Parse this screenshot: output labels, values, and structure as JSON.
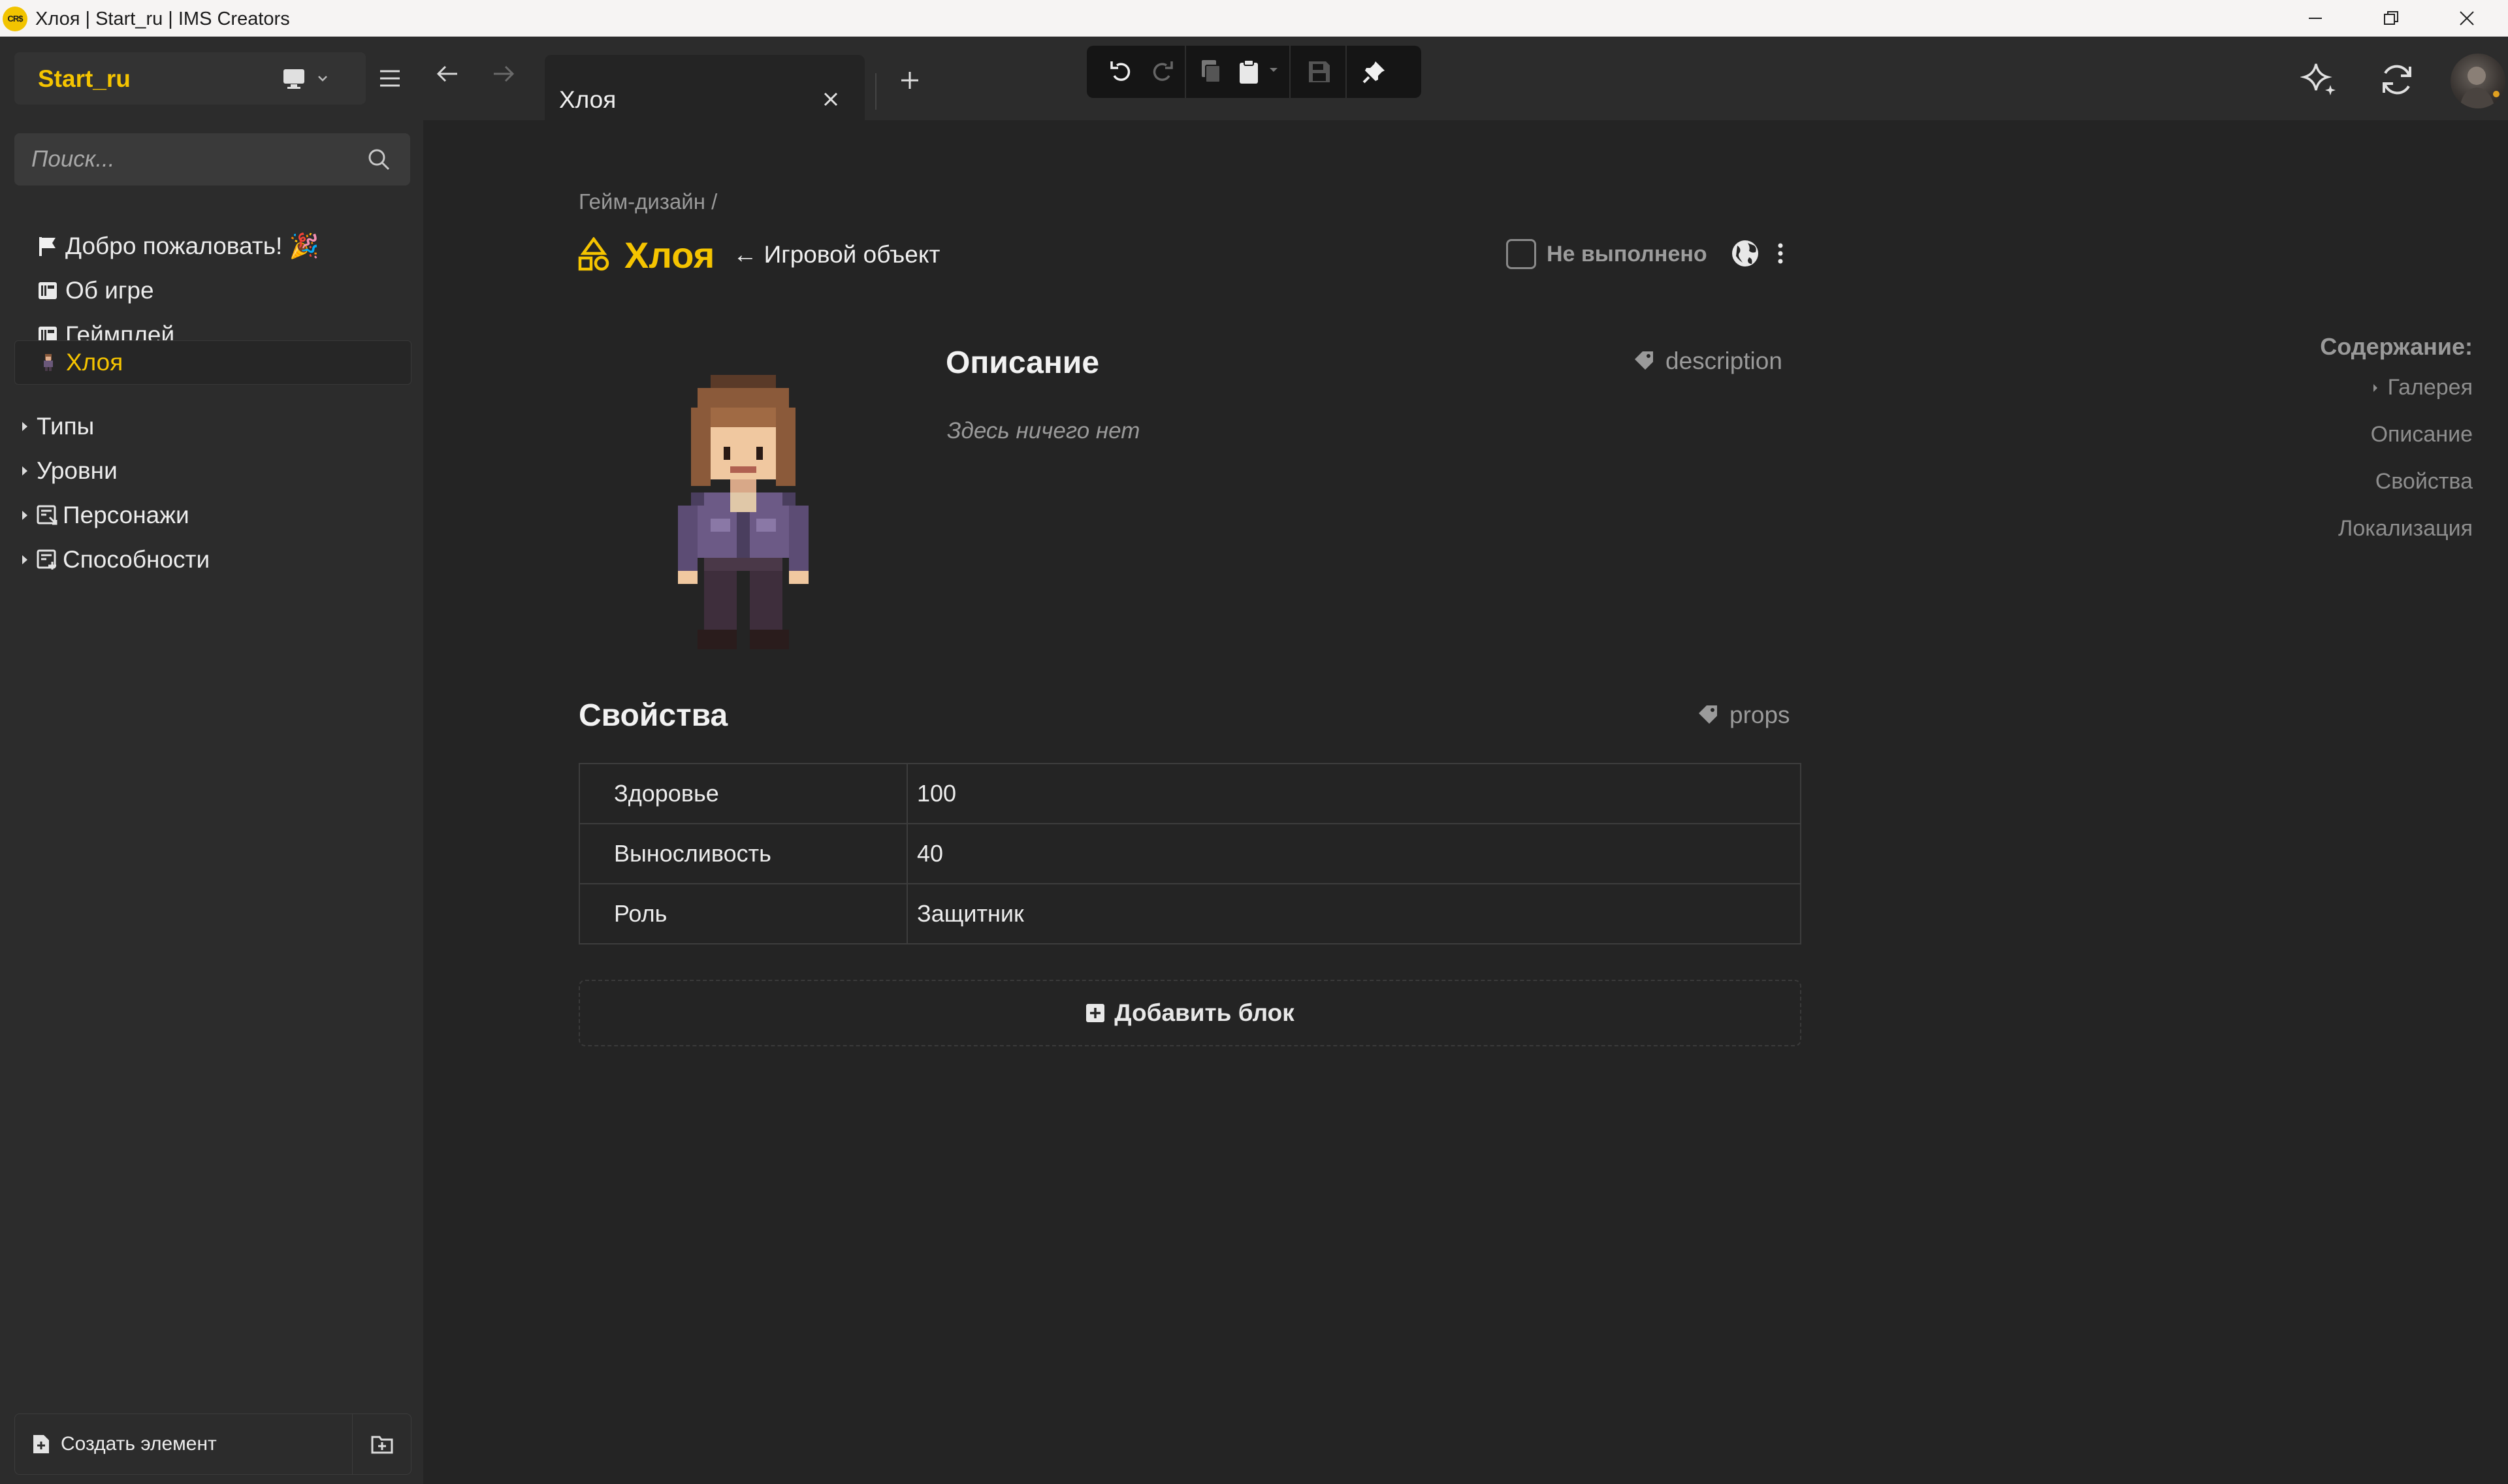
{
  "window": {
    "logo_text": "CR$",
    "title": "Хлоя | Start_ru | IMS Creators"
  },
  "sidebar": {
    "workspace": "Start_ru",
    "search_placeholder": "Поиск...",
    "items": [
      {
        "label": "Добро пожаловать! 🎉",
        "icon": "flag-icon"
      },
      {
        "label": "Об игре",
        "icon": "doc-card-icon"
      },
      {
        "label": "Геймплей",
        "icon": "doc-card-icon"
      },
      {
        "label": "Хлоя",
        "icon": "character-sprite-icon",
        "active": true
      },
      {
        "label": "Типы",
        "icon": "caret-right-icon"
      },
      {
        "label": "Уровни",
        "icon": "caret-right-icon"
      },
      {
        "label": "Персонажи",
        "icon": "collection-icon"
      },
      {
        "label": "Способности",
        "icon": "collection-icon"
      }
    ],
    "create_label": "Создать элемент"
  },
  "tabs": [
    {
      "label": "Хлоя",
      "active": true
    }
  ],
  "page": {
    "breadcrumb": "Гейм-дизайн /",
    "title": "Хлоя",
    "type_link": "← Игровой объект",
    "status": "Не выполнено",
    "description": {
      "heading": "Описание",
      "tag": "description",
      "empty": "Здесь ничего нет"
    },
    "props": {
      "heading": "Свойства",
      "tag": "props",
      "rows": [
        {
          "key": "Здоровье",
          "value": "100"
        },
        {
          "key": "Выносливость",
          "value": "40"
        },
        {
          "key": "Роль",
          "value": "Защитник"
        }
      ]
    },
    "add_block": "Добавить блок"
  },
  "toc": {
    "title": "Содержание:",
    "items": [
      "Галерея",
      "Описание",
      "Свойства",
      "Локализация"
    ]
  },
  "colors": {
    "accent": "#f5c400",
    "background": "#242424",
    "sidebar": "#2c2c2c"
  }
}
